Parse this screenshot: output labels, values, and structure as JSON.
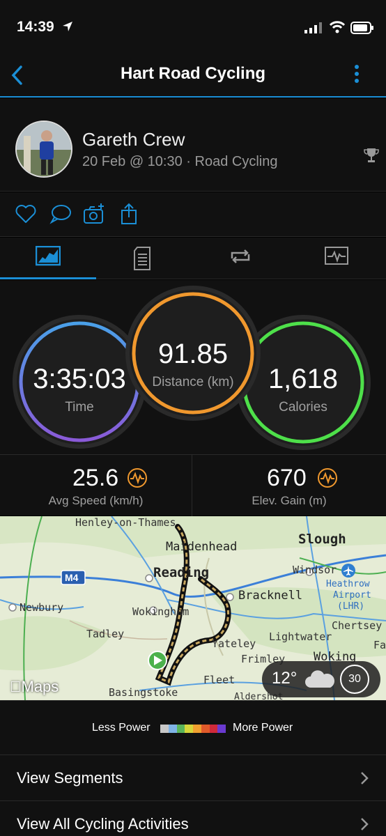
{
  "status_bar": {
    "time": "14:39"
  },
  "nav": {
    "title": "Hart Road Cycling"
  },
  "profile": {
    "name": "Gareth Crew",
    "meta": "20 Feb @ 10:30 · Road Cycling"
  },
  "stats": {
    "time": {
      "value": "3:35:03",
      "label": "Time"
    },
    "distance": {
      "value": "91.85",
      "label": "Distance (km)"
    },
    "calories": {
      "value": "1,618",
      "label": "Calories"
    }
  },
  "metrics": {
    "avg_speed": {
      "value": "25.6",
      "label": "Avg Speed (km/h)"
    },
    "elev_gain": {
      "value": "670",
      "label": "Elev. Gain (m)"
    }
  },
  "map": {
    "towns": {
      "henley": "Henley-on-Thames",
      "maidenhead": "Maidenhead",
      "slough": "Slough",
      "windsor": "Windsor",
      "heathrow": "Heathrow",
      "airport": "Airport",
      "lhr": "(LHR)",
      "reading": "Reading",
      "bracknell": "Bracknell",
      "newbury": "Newbury",
      "wokingham": "Wokingham",
      "lightwater": "Lightwater",
      "chertsey": "Chertsey",
      "tadley": "Tadley",
      "yateley": "Yateley",
      "frimley": "Frimley",
      "woking": "Woking",
      "fleet": "Fleet",
      "basingstoke": "Basingstoke",
      "aldershot": "Aldershot",
      "fa": "Fa"
    },
    "motorway": "M4",
    "attribution": "Maps",
    "weather": {
      "temp": "12°",
      "wind": "30"
    }
  },
  "legend": {
    "less": "Less Power",
    "more": "More Power",
    "colors": [
      "#c8c8c8",
      "#7fb3e6",
      "#5ab55a",
      "#d6d63a",
      "#f0a030",
      "#e05a2a",
      "#d02a3a",
      "#6a3ad0"
    ]
  },
  "list": [
    {
      "label": "View Segments"
    },
    {
      "label": "View All Cycling Activities"
    }
  ],
  "colors": {
    "accent": "#1b8fd6",
    "time_ring": "#5b7fe0",
    "distance_ring": "#f0982e",
    "calories_ring": "#4ee04a",
    "icon_orange": "#f0982e"
  }
}
